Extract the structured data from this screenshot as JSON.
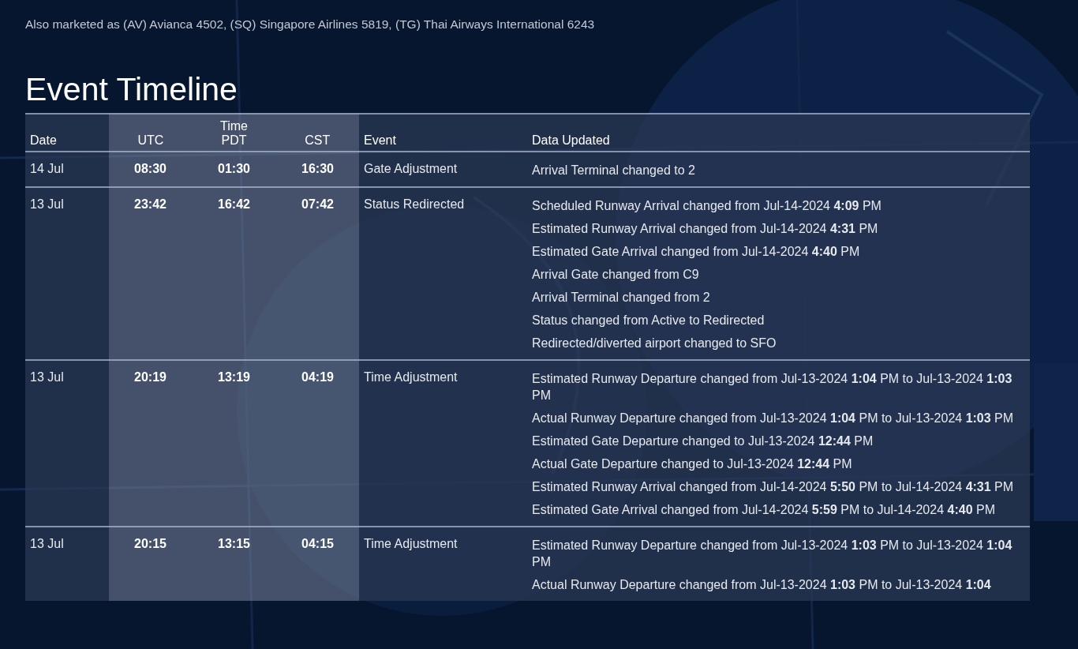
{
  "subtitle": "Also marketed as (AV) Avianca 4502, (SQ) Singapore Airlines 5819, (TG) Thai Airways International 6243",
  "section_title": "Event Timeline",
  "table": {
    "columns": {
      "date": "Date",
      "time_group": "Time",
      "utc": "UTC",
      "pdt": "PDT",
      "cst": "CST",
      "event": "Event",
      "data": "Data Updated"
    },
    "rows": [
      {
        "date": "14 Jul",
        "utc": "08:30",
        "pdt": "01:30",
        "cst": "16:30",
        "event": "Gate Adjustment",
        "changes": [
          "Arrival Terminal changed to 2"
        ]
      },
      {
        "date": "13 Jul",
        "utc": "23:42",
        "pdt": "16:42",
        "cst": "07:42",
        "event": "Status Redirected",
        "changes": [
          "Scheduled Runway Arrival changed from Jul-14-2024 **4:09** PM",
          "Estimated Runway Arrival changed from Jul-14-2024 **4:31** PM",
          "Estimated Gate Arrival changed from Jul-14-2024 **4:40** PM",
          "Arrival Gate changed from C9",
          "Arrival Terminal changed from 2",
          "Status changed from Active to Redirected",
          "Redirected/diverted airport changed to SFO"
        ]
      },
      {
        "date": "13 Jul",
        "utc": "20:19",
        "pdt": "13:19",
        "cst": "04:19",
        "event": "Time Adjustment",
        "changes": [
          "Estimated Runway Departure changed from Jul-13-2024 **1:04** PM to Jul-13-2024 **1:03** PM",
          "Actual Runway Departure changed from Jul-13-2024 **1:04** PM to Jul-13-2024 **1:03** PM",
          "Estimated Gate Departure changed to Jul-13-2024 **12:44** PM",
          "Actual Gate Departure changed to Jul-13-2024 **12:44** PM",
          "Estimated Runway Arrival changed from Jul-14-2024 **5:50** PM to Jul-14-2024 **4:31** PM",
          "Estimated Gate Arrival changed from Jul-14-2024 **5:59** PM to Jul-14-2024 **4:40** PM"
        ]
      },
      {
        "date": "13 Jul",
        "utc": "20:15",
        "pdt": "13:15",
        "cst": "04:15",
        "event": "Time Adjustment",
        "changes": [
          "Estimated Runway Departure changed from Jul-13-2024 **1:03** PM to Jul-13-2024 **1:04** PM",
          "Actual Runway Departure changed from Jul-13-2024 **1:03** PM to Jul-13-2024 **1:04**"
        ]
      }
    ]
  }
}
